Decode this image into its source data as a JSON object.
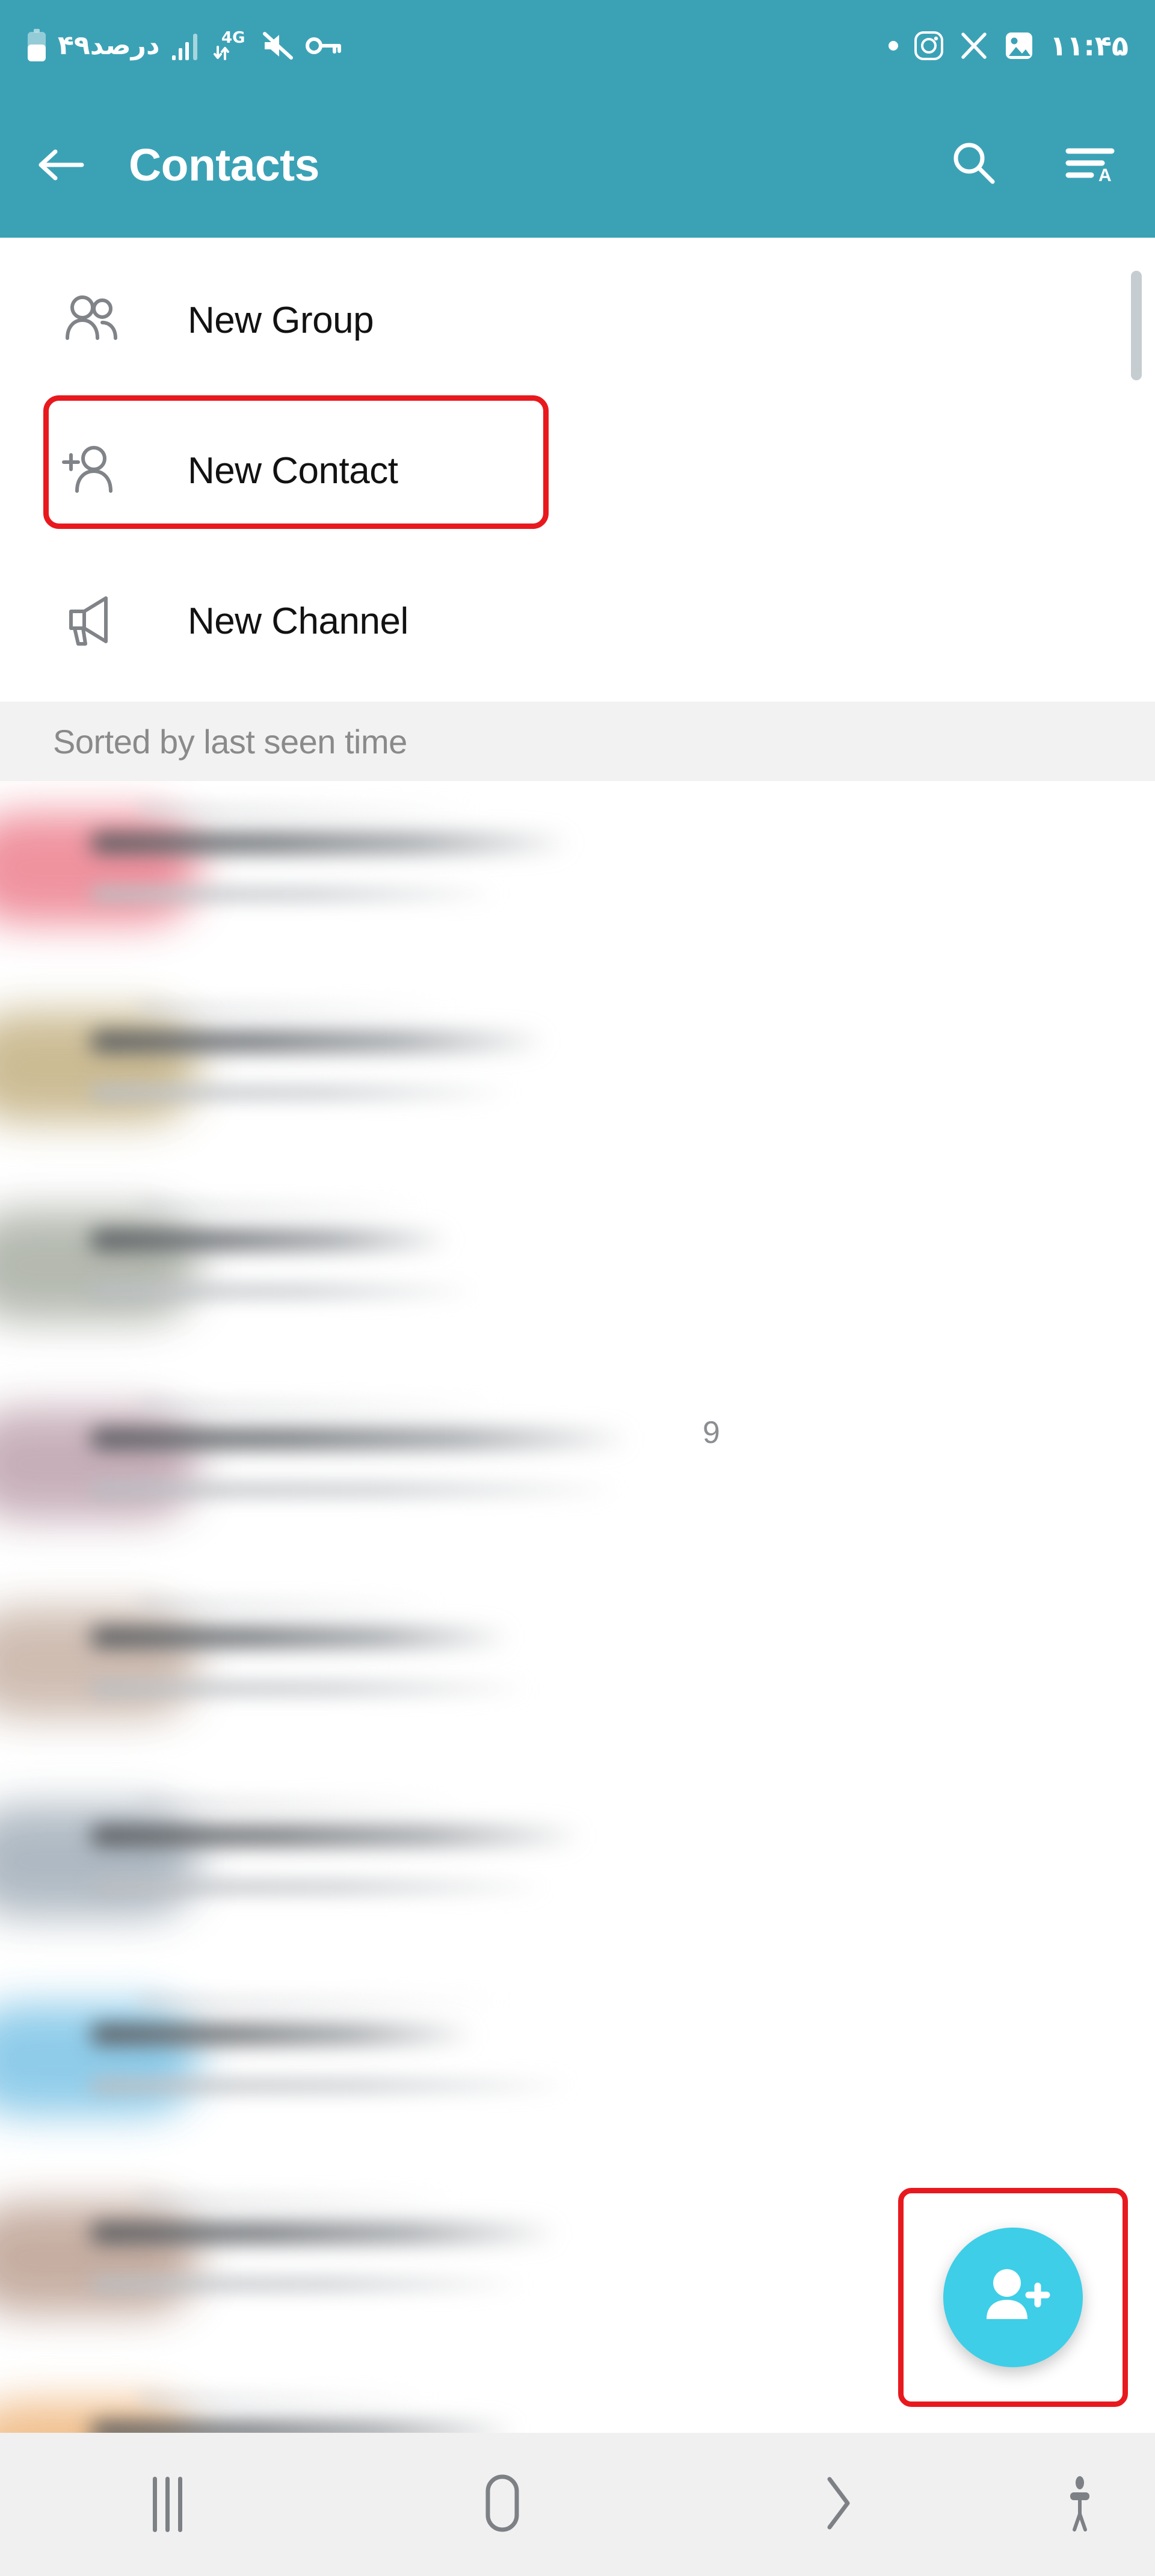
{
  "status_bar": {
    "battery_percent_label": "۴۹درصد",
    "network_type": "4G",
    "clock": "۱۱:۴۵",
    "left_icons": [
      "battery-icon",
      "signal-bars-icon",
      "data-transfer-icon",
      "mute-icon",
      "vpn-key-icon"
    ],
    "right_icons": [
      "dot-indicator",
      "instagram-icon",
      "x-twitter-icon",
      "gallery-icon"
    ]
  },
  "toolbar": {
    "title": "Contacts",
    "back_label": "Back",
    "search_label": "Search",
    "sort_label": "Sort"
  },
  "create_menu": {
    "items": [
      {
        "label": "New Group",
        "icon": "group-icon"
      },
      {
        "label": "New Contact",
        "icon": "person-add-icon"
      },
      {
        "label": "New Channel",
        "icon": "megaphone-icon"
      }
    ]
  },
  "section": {
    "sorted_label": "Sorted by last seen time"
  },
  "contact_list": {
    "trailing_digit": "9",
    "rows": [
      {
        "avatar_color": "#EE8A97",
        "name_width": 800,
        "status_width": 680,
        "ghost_width": 560
      },
      {
        "avatar_color": "#C8B78C",
        "name_width": 760,
        "status_width": 700,
        "ghost_width": 520
      },
      {
        "avatar_color": "#AFB4AA",
        "name_width": 600,
        "status_width": 640,
        "ghost_width": 470
      },
      {
        "avatar_color": "#C3A9B4",
        "name_width": 900,
        "status_width": 880,
        "ghost_width": 600
      },
      {
        "avatar_color": "#CBB8AC",
        "name_width": 700,
        "status_width": 730,
        "ghost_width": 500
      },
      {
        "avatar_color": "#A9B4BE",
        "name_width": 820,
        "status_width": 760,
        "ghost_width": 540
      },
      {
        "avatar_color": "#86C8E8",
        "name_width": 640,
        "status_width": 800,
        "ghost_width": 610
      },
      {
        "avatar_color": "#C2A89B",
        "name_width": 780,
        "status_width": 720,
        "ghost_width": 530
      },
      {
        "avatar_color": "#F0BC87",
        "name_width": 710,
        "status_width": 760,
        "ghost_width": 490
      }
    ]
  },
  "fab": {
    "icon": "person-add-icon",
    "label": "Add contact",
    "color": "#3ECEE8"
  },
  "highlights": {
    "color": "#E8191E",
    "targets": [
      "new-contact-menu-item",
      "add-contact-fab"
    ]
  },
  "nav_bar": {
    "buttons": [
      {
        "name": "recents",
        "icon": "recents-icon"
      },
      {
        "name": "home",
        "icon": "home-icon"
      },
      {
        "name": "back",
        "icon": "chevron-right-icon"
      },
      {
        "name": "accessibility",
        "icon": "accessibility-icon"
      }
    ]
  },
  "colors": {
    "toolbar": "#3BA2B6",
    "accent": "#3ECEE8",
    "highlight": "#E8191E",
    "section_bg": "#F2F2F2",
    "nav_bg": "#F0F0F0"
  }
}
